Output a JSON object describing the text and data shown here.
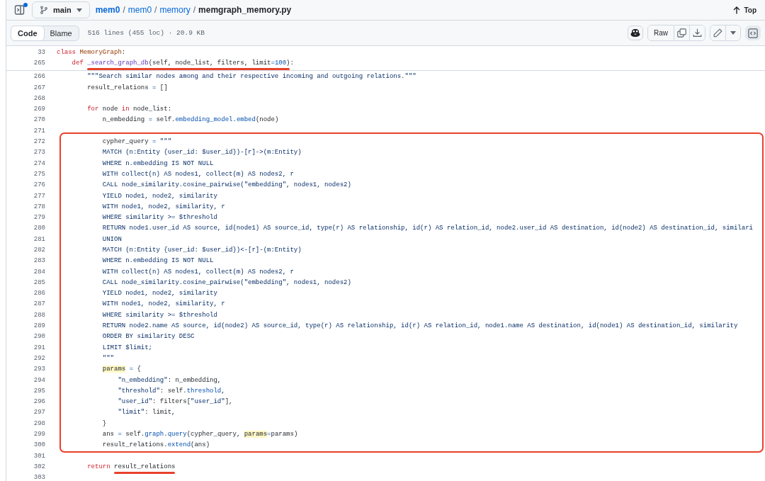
{
  "top_bar": {
    "branch": "main",
    "breadcrumb": [
      {
        "label": "mem0",
        "link": true
      },
      {
        "label": "mem0",
        "link": true
      },
      {
        "label": "memory",
        "link": true
      },
      {
        "label": "memgraph_memory.py",
        "link": false
      }
    ],
    "separator": "/",
    "top_link": "Top",
    "sidebar_notification": true
  },
  "toolbar": {
    "tabs": [
      {
        "label": "Code",
        "selected": true
      },
      {
        "label": "Blame",
        "selected": false
      }
    ],
    "file_info": "516 lines (455 loc) · 20.9 KB",
    "raw": "Raw",
    "symbols_pressed": true
  },
  "sticky_lines": [
    {
      "number": "33",
      "tokens": [
        {
          "kind": "kw",
          "text": "class "
        },
        {
          "kind": "cls",
          "text": "MemoryGraph"
        },
        {
          "kind": "plain",
          "text": ":"
        }
      ]
    },
    {
      "number": "265",
      "tokens": [
        {
          "kind": "kw",
          "text": "    def "
        },
        {
          "kind": "mark",
          "tokens": [
            {
              "kind": "fn",
              "text": "_search_graph_db"
            },
            {
              "kind": "plain",
              "text": "(self, node_list, filters, limit"
            },
            {
              "kind": "op",
              "text": "="
            },
            {
              "kind": "num",
              "text": "100"
            },
            {
              "kind": "plain",
              "text": ")"
            }
          ]
        },
        {
          "kind": "plain",
          "text": ":"
        }
      ]
    }
  ],
  "code_blocks": [
    {
      "kind": "plain",
      "lines": [
        {
          "number": "266",
          "tokens": [
            {
              "kind": "str",
              "text": "        \"\"\"Search similar nodes among and their respective incoming and outgoing relations.\"\"\""
            }
          ]
        },
        {
          "number": "267",
          "tokens": [
            {
              "kind": "plain",
              "text": "        result_relations "
            },
            {
              "kind": "op",
              "text": "="
            },
            {
              "kind": "plain",
              "text": " []"
            }
          ]
        },
        {
          "number": "268"
        },
        {
          "number": "269",
          "tokens": [
            {
              "kind": "kw",
              "text": "        for"
            },
            {
              "kind": "plain",
              "text": " node "
            },
            {
              "kind": "kw",
              "text": "in"
            },
            {
              "kind": "plain",
              "text": " node_list:"
            }
          ]
        },
        {
          "number": "270",
          "tokens": [
            {
              "kind": "plain",
              "text": "            n_embedding "
            },
            {
              "kind": "op",
              "text": "="
            },
            {
              "kind": "plain",
              "text": " self."
            },
            {
              "kind": "attr",
              "text": "embedding_model"
            },
            {
              "kind": "plain",
              "text": "."
            },
            {
              "kind": "attr",
              "text": "embed"
            },
            {
              "kind": "plain",
              "text": "(node)"
            }
          ]
        },
        {
          "number": "271"
        }
      ]
    },
    {
      "kind": "boxed",
      "lines": [
        {
          "number": "272",
          "tokens": [
            {
              "kind": "plain",
              "text": "            cypher_query "
            },
            {
              "kind": "op",
              "text": "="
            },
            {
              "kind": "str",
              "text": " \"\"\""
            }
          ]
        },
        {
          "number": "273",
          "tokens": [
            {
              "kind": "str",
              "text": "            MATCH (n:Entity {user_id: $user_id})-[r]->(m:Entity)"
            }
          ]
        },
        {
          "number": "274",
          "tokens": [
            {
              "kind": "str",
              "text": "            WHERE n.embedding IS NOT NULL"
            }
          ]
        },
        {
          "number": "275",
          "tokens": [
            {
              "kind": "str",
              "text": "            WITH collect(n) AS nodes1, collect(m) AS nodes2, r"
            }
          ]
        },
        {
          "number": "276",
          "tokens": [
            {
              "kind": "str",
              "text": "            CALL node_similarity.cosine_pairwise(\"embedding\", nodes1, nodes2)"
            }
          ]
        },
        {
          "number": "277",
          "tokens": [
            {
              "kind": "str",
              "text": "            YIELD node1, node2, similarity"
            }
          ]
        },
        {
          "number": "278",
          "tokens": [
            {
              "kind": "str",
              "text": "            WITH node1, node2, similarity, r"
            }
          ]
        },
        {
          "number": "279",
          "tokens": [
            {
              "kind": "str",
              "text": "            WHERE similarity >= $threshold"
            }
          ]
        },
        {
          "number": "280",
          "tokens": [
            {
              "kind": "str",
              "text": "            RETURN node1.user_id AS source, id(node1) AS source_id, type(r) AS relationship, id(r) AS relation_id, node2.user_id AS destination, id(node2) AS destination_id, similari"
            }
          ]
        },
        {
          "number": "281",
          "tokens": [
            {
              "kind": "str",
              "text": "            UNION"
            }
          ]
        },
        {
          "number": "282",
          "tokens": [
            {
              "kind": "str",
              "text": "            MATCH (n:Entity {user_id: $user_id})<-[r]-(m:Entity)"
            }
          ]
        },
        {
          "number": "283",
          "tokens": [
            {
              "kind": "str",
              "text": "            WHERE n.embedding IS NOT NULL"
            }
          ]
        },
        {
          "number": "284",
          "tokens": [
            {
              "kind": "str",
              "text": "            WITH collect(n) AS nodes1, collect(m) AS nodes2, r"
            }
          ]
        },
        {
          "number": "285",
          "tokens": [
            {
              "kind": "str",
              "text": "            CALL node_similarity.cosine_pairwise(\"embedding\", nodes1, nodes2)"
            }
          ]
        },
        {
          "number": "286",
          "tokens": [
            {
              "kind": "str",
              "text": "            YIELD node1, node2, similarity"
            }
          ]
        },
        {
          "number": "287",
          "tokens": [
            {
              "kind": "str",
              "text": "            WITH node1, node2, similarity, r"
            }
          ]
        },
        {
          "number": "288",
          "tokens": [
            {
              "kind": "str",
              "text": "            WHERE similarity >= $threshold"
            }
          ]
        },
        {
          "number": "289",
          "tokens": [
            {
              "kind": "str",
              "text": "            RETURN node2.name AS source, id(node2) AS source_id, type(r) AS relationship, id(r) AS relation_id, node1.name AS destination, id(node1) AS destination_id, similarity"
            }
          ]
        },
        {
          "number": "290",
          "tokens": [
            {
              "kind": "str",
              "text": "            ORDER BY similarity DESC"
            }
          ]
        },
        {
          "number": "291",
          "tokens": [
            {
              "kind": "str",
              "text": "            LIMIT $limit;"
            }
          ]
        },
        {
          "number": "292",
          "tokens": [
            {
              "kind": "str",
              "text": "            \"\"\""
            }
          ]
        },
        {
          "number": "293",
          "tokens": [
            {
              "kind": "hl",
              "text": "            params"
            },
            {
              "kind": "op",
              "text": " ="
            },
            {
              "kind": "plain",
              "text": " {"
            }
          ]
        },
        {
          "number": "294",
          "tokens": [
            {
              "kind": "str",
              "text": "                \"n_embedding\""
            },
            {
              "kind": "plain",
              "text": ": n_embedding,"
            }
          ]
        },
        {
          "number": "295",
          "tokens": [
            {
              "kind": "str",
              "text": "                \"threshold\""
            },
            {
              "kind": "plain",
              "text": ": self."
            },
            {
              "kind": "attr",
              "text": "threshold"
            },
            {
              "kind": "plain",
              "text": ","
            }
          ]
        },
        {
          "number": "296",
          "tokens": [
            {
              "kind": "str",
              "text": "                \"user_id\""
            },
            {
              "kind": "plain",
              "text": ": filters["
            },
            {
              "kind": "str",
              "text": "\"user_id\""
            },
            {
              "kind": "plain",
              "text": "],"
            }
          ]
        },
        {
          "number": "297",
          "tokens": [
            {
              "kind": "str",
              "text": "                \"limit\""
            },
            {
              "kind": "plain",
              "text": ": limit,"
            }
          ]
        },
        {
          "number": "298",
          "tokens": [
            {
              "kind": "plain",
              "text": "            }"
            }
          ]
        },
        {
          "number": "299",
          "tokens": [
            {
              "kind": "plain",
              "text": "            ans "
            },
            {
              "kind": "op",
              "text": "="
            },
            {
              "kind": "plain",
              "text": " self."
            },
            {
              "kind": "attr",
              "text": "graph"
            },
            {
              "kind": "plain",
              "text": "."
            },
            {
              "kind": "attr",
              "text": "query"
            },
            {
              "kind": "plain",
              "text": "(cypher_query, "
            },
            {
              "kind": "hl",
              "text": "params"
            },
            {
              "kind": "op",
              "text": "="
            },
            {
              "kind": "plain",
              "text": "params)"
            }
          ]
        },
        {
          "number": "300",
          "tokens": [
            {
              "kind": "plain",
              "text": "            result_relations."
            },
            {
              "kind": "attr",
              "text": "extend"
            },
            {
              "kind": "plain",
              "text": "(ans)"
            }
          ]
        }
      ]
    },
    {
      "kind": "plain",
      "lines": [
        {
          "number": "301"
        },
        {
          "number": "302",
          "tokens": [
            {
              "kind": "kw",
              "text": "        return "
            },
            {
              "kind": "mark",
              "tokens": [
                {
                  "kind": "plain",
                  "text": "result_relations"
                }
              ]
            }
          ]
        },
        {
          "number": "303"
        }
      ]
    }
  ]
}
